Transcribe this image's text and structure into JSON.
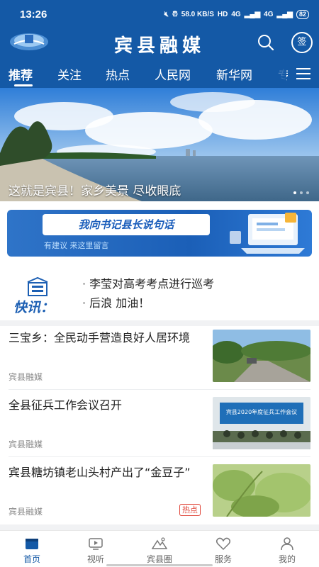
{
  "status_bar": {
    "time": "13:26",
    "net_speed": "58.0 KB/S",
    "hd": "HD",
    "sim1": "4G",
    "sim2": "4G",
    "battery": "82"
  },
  "header": {
    "title": "宾县融媒",
    "sign_label": "签",
    "icons": {
      "search": "search-icon",
      "logo": "app-logo"
    }
  },
  "tabs": [
    {
      "label": "推荐",
      "active": true
    },
    {
      "label": "关注"
    },
    {
      "label": "热点"
    },
    {
      "label": "人民网"
    },
    {
      "label": "新华网"
    },
    {
      "label": "专"
    }
  ],
  "banner": {
    "caption": "这就是宾县！家乡美景 尽收眼底"
  },
  "promo": {
    "title": "我向书记县长说句话",
    "subtitle": "有建议 来这里留言"
  },
  "news_flash": {
    "label": "快讯：",
    "items": [
      "李莹对高考考点进行巡考",
      "后浪 加油！"
    ]
  },
  "news": [
    {
      "title": "三宝乡：全民动手营造良好人居环境",
      "source": "宾县融媒",
      "badge": ""
    },
    {
      "title": "全县征兵工作会议召开",
      "source": "宾县融媒",
      "badge": "",
      "thumb_text": "宾县2020年度征兵工作会议"
    },
    {
      "title": "宾县糖坊镇老山头村产出了“金豆子”",
      "source": "宾县融媒",
      "badge": "热点"
    }
  ],
  "bottom_nav": [
    {
      "label": "首页",
      "icon": "home-icon",
      "active": true
    },
    {
      "label": "视听",
      "icon": "tv-icon"
    },
    {
      "label": "宾县圈",
      "icon": "mountain-icon"
    },
    {
      "label": "服务",
      "icon": "heart-icon"
    },
    {
      "label": "我的",
      "icon": "user-icon"
    }
  ],
  "colors": {
    "brand": "#1459a6",
    "hot": "#e0463a"
  }
}
